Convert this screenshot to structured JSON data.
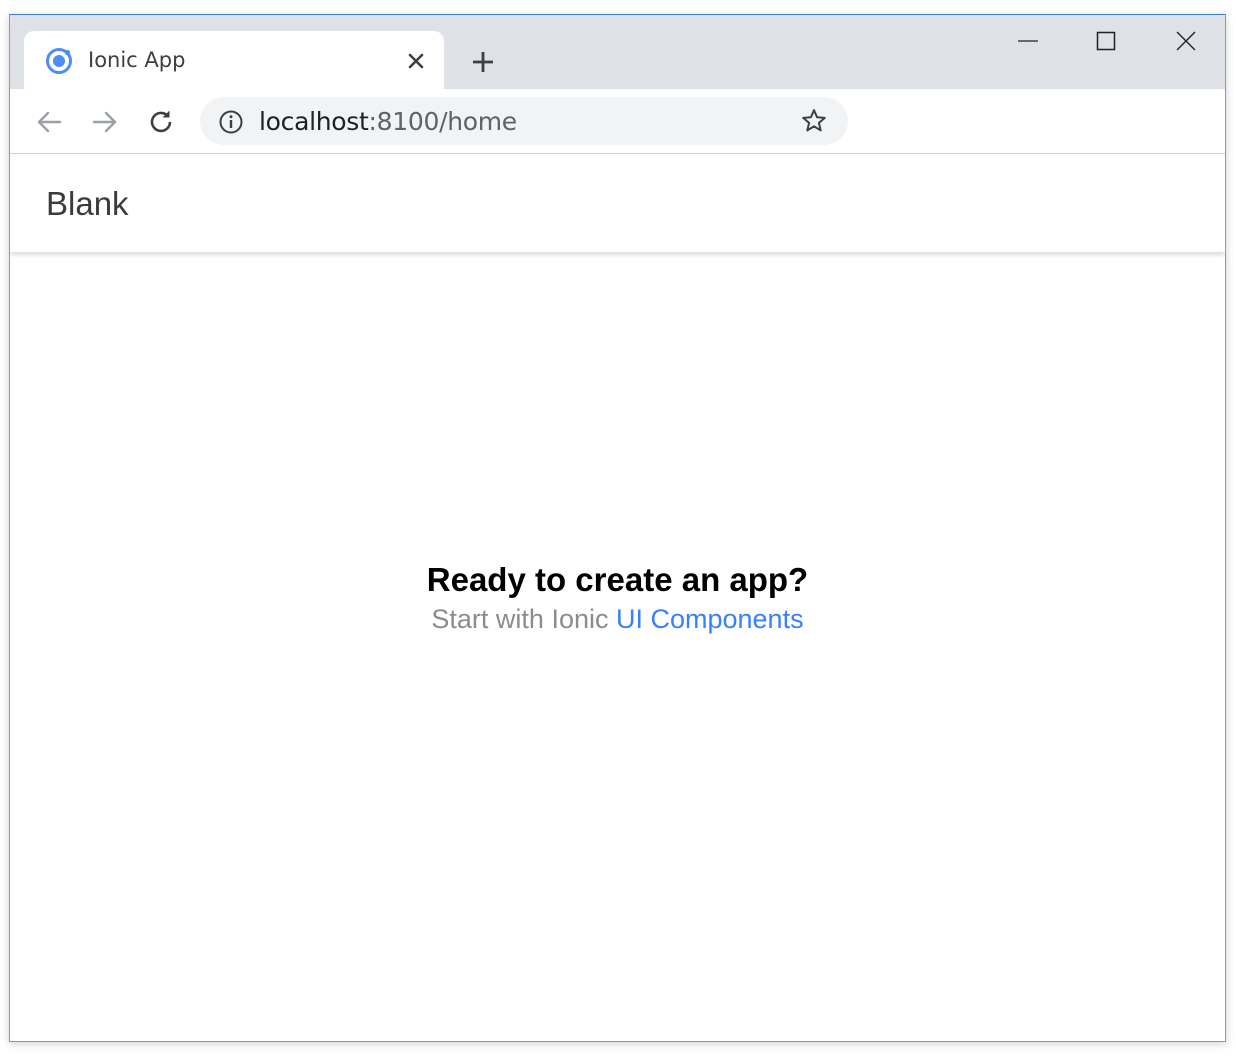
{
  "browser": {
    "tab": {
      "title": "Ionic App",
      "favicon": "ionic-logo-icon"
    },
    "new_tab_icon": "plus-icon",
    "window_controls": [
      "minimize-icon",
      "maximize-icon",
      "close-icon"
    ],
    "nav": {
      "back_icon": "arrow-left-icon",
      "forward_icon": "arrow-right-icon",
      "reload_icon": "reload-icon"
    },
    "address": {
      "host": "localhost",
      "rest": ":8100/home",
      "bookmark_icon": "star-icon",
      "site_info_icon": "info-icon"
    }
  },
  "app": {
    "header": {
      "title": "Blank"
    },
    "content": {
      "headline": "Ready to create an app?",
      "sub_prefix": "Start with Ionic ",
      "link_text": "UI Components"
    }
  },
  "colors": {
    "ionic_blue": "#3880ff",
    "tab_strip": "#dee1e6",
    "omnibox": "#f1f3f4",
    "muted_text": "#8c8c8c"
  }
}
